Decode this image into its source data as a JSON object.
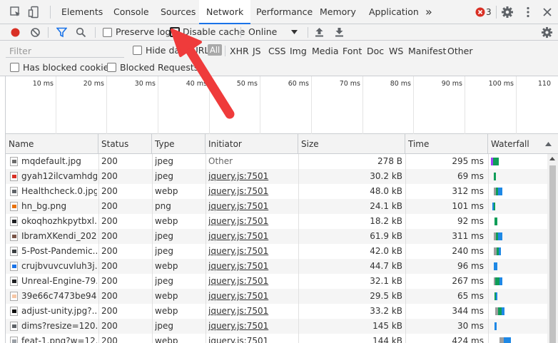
{
  "tabs": [
    {
      "label": "Elements",
      "active": false
    },
    {
      "label": "Console",
      "active": false
    },
    {
      "label": "Sources",
      "active": false
    },
    {
      "label": "Network",
      "active": true
    },
    {
      "label": "Performance",
      "active": false
    },
    {
      "label": "Memory",
      "active": false
    },
    {
      "label": "Application",
      "active": false
    }
  ],
  "tabbar": {
    "more_tabs": "»",
    "error_count": "3",
    "error_color": "#d93025",
    "accent": "#1a73e8"
  },
  "toolbar": {
    "preserve_log": "Preserve log",
    "disable_cache": "Disable cache",
    "throttling": "Online",
    "record_color": "#d93025",
    "filter_color": "#1a73e8"
  },
  "filterbar": {
    "filter_placeholder": "Filter",
    "hide_data_urls": "Hide data URLs",
    "types": [
      "All",
      "XHR",
      "JS",
      "CSS",
      "Img",
      "Media",
      "Font",
      "Doc",
      "WS",
      "Manifest",
      "Other"
    ],
    "active_type": "All",
    "blocked_cookies": "Has blocked cookies",
    "blocked_requests": "Blocked Requests"
  },
  "overview": {
    "ticks": [
      "10 ms",
      "20 ms",
      "30 ms",
      "40 ms",
      "50 ms",
      "60 ms",
      "70 ms",
      "80 ms",
      "90 ms",
      "100 ms",
      "110"
    ]
  },
  "table": {
    "columns": [
      "Name",
      "Status",
      "Type",
      "Initiator",
      "Size",
      "Time",
      "Waterfall"
    ],
    "rows": [
      {
        "name": "mqdefault.jpg",
        "status": "200",
        "type": "jpeg",
        "initiator": "Other",
        "link": false,
        "size": "278 B",
        "time": "295 ms",
        "icon": "#6d6d6d"
      },
      {
        "name": "gyah12ilcvamhdg...",
        "status": "200",
        "type": "jpeg",
        "initiator": "jquery.js:7501",
        "link": true,
        "size": "30.2 kB",
        "time": "69 ms",
        "icon": "#d93025"
      },
      {
        "name": "Healthcheck.0.jpg",
        "status": "200",
        "type": "webp",
        "initiator": "jquery.js:7501",
        "link": true,
        "size": "48.0 kB",
        "time": "312 ms",
        "icon": "#5f6368"
      },
      {
        "name": "hn_bg.png",
        "status": "200",
        "type": "png",
        "initiator": "jquery.js:7501",
        "link": true,
        "size": "24.1 kB",
        "time": "101 ms",
        "icon": "#e8710a"
      },
      {
        "name": "okoqhozhkpytbxl...",
        "status": "200",
        "type": "webp",
        "initiator": "jquery.js:7501",
        "link": true,
        "size": "18.2 kB",
        "time": "92 ms",
        "icon": "#202124"
      },
      {
        "name": "IbramXKendi_202...",
        "status": "200",
        "type": "jpeg",
        "initiator": "jquery.js:7501",
        "link": true,
        "size": "61.9 kB",
        "time": "311 ms",
        "icon": "#795548"
      },
      {
        "name": "5-Post-Pandemic...",
        "status": "200",
        "type": "jpeg",
        "initiator": "jquery.js:7501",
        "link": true,
        "size": "42.0 kB",
        "time": "240 ms",
        "icon": "#3c4043"
      },
      {
        "name": "crujbvuvcuvluh3j...",
        "status": "200",
        "type": "webp",
        "initiator": "jquery.js:7501",
        "link": true,
        "size": "44.7 kB",
        "time": "96 ms",
        "icon": "#1a73e8"
      },
      {
        "name": "Unreal-Engine-79...",
        "status": "200",
        "type": "jpeg",
        "initiator": "jquery.js:7501",
        "link": true,
        "size": "32.1 kB",
        "time": "267 ms",
        "icon": "#202124"
      },
      {
        "name": "39e66c7473be94...",
        "status": "200",
        "type": "webp",
        "initiator": "jquery.js:7501",
        "link": true,
        "size": "29.5 kB",
        "time": "65 ms",
        "icon": "#f6c7a6"
      },
      {
        "name": "adjust-unity.jpg?...",
        "status": "200",
        "type": "webp",
        "initiator": "jquery.js:7501",
        "link": true,
        "size": "33.2 kB",
        "time": "344 ms",
        "icon": "#111111"
      },
      {
        "name": "dims?resize=120...",
        "status": "200",
        "type": "jpeg",
        "initiator": "jquery.js:7501",
        "link": true,
        "size": "145 kB",
        "time": "30 ms",
        "icon": "#5f6368"
      },
      {
        "name": "feat-1.png?w=12...",
        "status": "200",
        "type": "webp",
        "initiator": "jquery.js:7501",
        "link": true,
        "size": "144 kB",
        "time": "424 ms",
        "icon": "#9aa0a6"
      }
    ]
  },
  "waterfall_colors": {
    "queue": "#a142f4",
    "wait": "#0f9d58",
    "download": "#1e88e5",
    "stall": "#9e9e9e"
  },
  "annotation": {
    "arrow_color": "#ef3b3b"
  }
}
